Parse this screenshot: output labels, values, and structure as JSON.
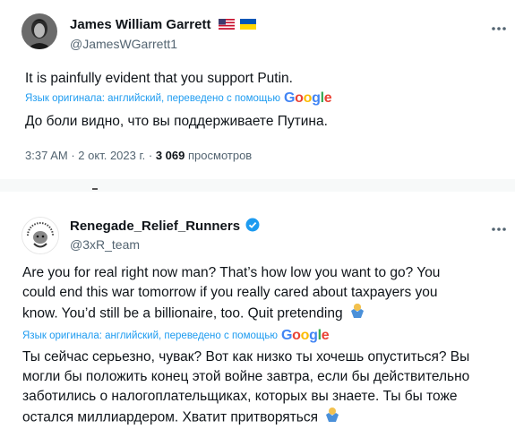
{
  "tweet1": {
    "display_name": "James William Garrett",
    "handle": "@JamesWGarrett1",
    "text_original": "It is painfully evident that you support Putin.",
    "translation_note": "Язык оригинала: английский, переведено с помощью",
    "translator_brand": "Google",
    "text_translated": "До боли видно, что вы поддерживаете Путина.",
    "time": "3:37 AM",
    "date": "2 окт. 2023 г.",
    "views_count": "3 069",
    "views_label": "просмотров",
    "sep": "·",
    "flag_icons": [
      "us-flag-icon",
      "ukraine-flag-icon"
    ]
  },
  "tweet2": {
    "display_name": "Renegade_Relief_Runners",
    "handle": "@3xR_team",
    "text_line1": "Are you for real right now man?  That’s how low you want to go?  You",
    "text_line2": "could end this war tomorrow if you really cared about taxpayers you",
    "text_line3": "know.  You’d still be a billionaire, too.  Quit pretending",
    "translation_note": "Язык оригинала: английский, переведено с помощью",
    "translator_brand": "Google",
    "tr_line1": "Ты сейчас серьезно, чувак? Вот как низко ты хочешь опуститься? Вы",
    "tr_line2": "могли бы положить конец этой войне завтра, если бы действительно",
    "tr_line3": "заботились о налогоплательщиках, которых вы знаете. Ты бы тоже",
    "tr_line4": "остался миллиардером. Хватит притворяться",
    "verified_icon": "verified-badge-icon",
    "emoji_icon": "person-shrugging-emoji"
  },
  "colors": {
    "link_blue": "#1d9bf0",
    "secondary_text": "#536471",
    "primary_text": "#0f1419"
  }
}
